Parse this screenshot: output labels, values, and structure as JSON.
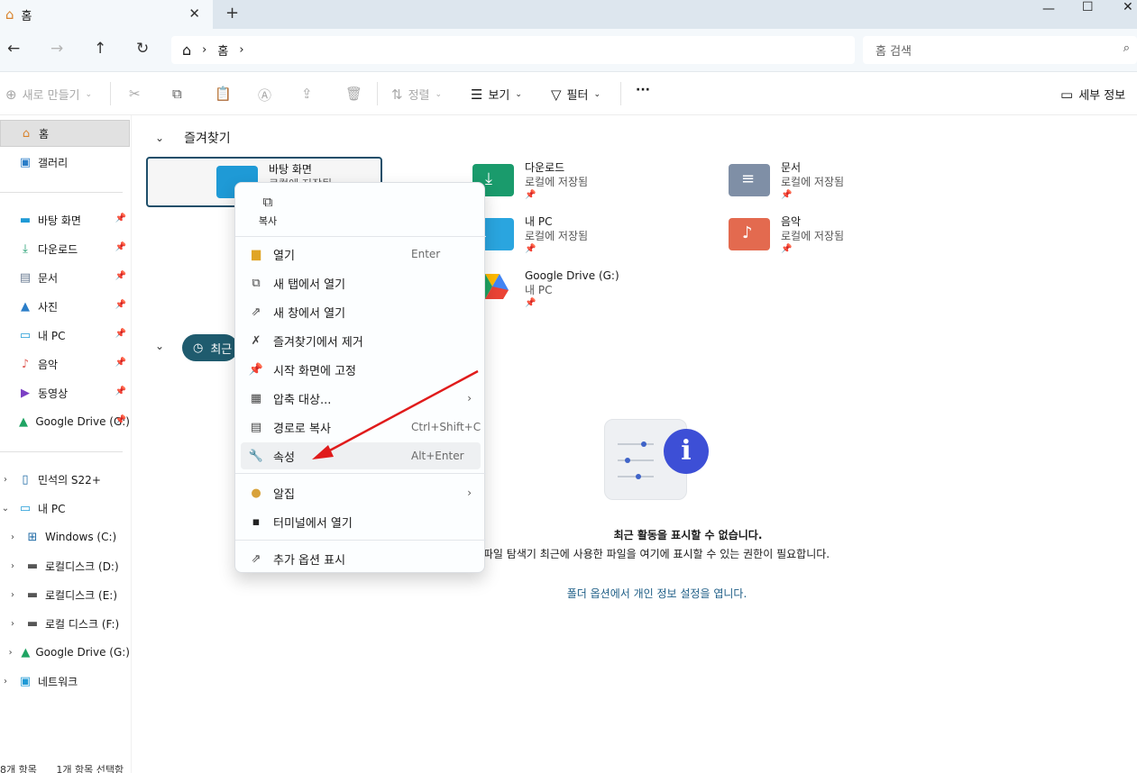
{
  "tab": {
    "title": "홈",
    "close": "✕",
    "new_tab": "+"
  },
  "window_controls": {
    "minimize": "—",
    "maximize": "☐",
    "close": "✕"
  },
  "address": {
    "home_icon": "⌂",
    "sep1": "›",
    "crumb": "홈",
    "sep2": "›"
  },
  "search": {
    "placeholder": "홈 검색"
  },
  "toolbar": {
    "new": "새로 만들기",
    "sort": "정렬",
    "view": "보기",
    "filter": "필터",
    "more": "···",
    "details": "세부 정보"
  },
  "sidebar": {
    "pinned": [
      {
        "label": "홈"
      },
      {
        "label": "갤러리"
      }
    ],
    "quick": [
      {
        "label": "바탕 화면"
      },
      {
        "label": "다운로드"
      },
      {
        "label": "문서"
      },
      {
        "label": "사진"
      },
      {
        "label": "내 PC"
      },
      {
        "label": "음악"
      },
      {
        "label": "동영상"
      },
      {
        "label": "Google Drive (G:)"
      }
    ],
    "tree": [
      {
        "label": "민석의 S22+"
      },
      {
        "label": "내 PC"
      },
      {
        "label": "Windows (C:)"
      },
      {
        "label": "로컬디스크 (D:)"
      },
      {
        "label": "로컬디스크 (E:)"
      },
      {
        "label": "로컬 디스크 (F:)"
      },
      {
        "label": "Google Drive (G:)"
      },
      {
        "label": "네트워크"
      }
    ]
  },
  "status": {
    "count": "8개 항목",
    "selected": "1개 항목 선택함"
  },
  "main": {
    "favorites_title": "즐겨찾기",
    "recent_label": "최근",
    "favorites": [
      {
        "name": "바탕 화면",
        "sub": "로컬에 저장됨"
      },
      {
        "name": "다운로드",
        "sub": "로컬에 저장됨"
      },
      {
        "name": "문서",
        "sub": "로컬에 저장됨"
      },
      {
        "name": "내 PC",
        "sub": "로컬에 저장됨"
      },
      {
        "name": "음악",
        "sub": "로컬에 저장됨"
      },
      {
        "name": "Google Drive (G:)",
        "sub": "내 PC"
      }
    ],
    "empty_title": "최근 활동을 표시할 수 없습니다.",
    "empty_desc": "파일 탐색기 최근에 사용한 파일을 여기에 표시할 수 있는 권한이 필요합니다.",
    "empty_link": "폴더 옵션에서 개인 정보 설정을 엽니다."
  },
  "context_menu": {
    "copy": "복사",
    "items": [
      {
        "label": "열기",
        "shortcut": "Enter"
      },
      {
        "label": "새 탭에서 열기"
      },
      {
        "label": "새 창에서 열기"
      },
      {
        "label": "즐겨찾기에서 제거"
      },
      {
        "label": "시작 화면에 고정"
      },
      {
        "label": "압축 대상..."
      },
      {
        "label": "경로로 복사",
        "shortcut": "Ctrl+Shift+C"
      },
      {
        "label": "속성",
        "shortcut": "Alt+Enter"
      },
      {
        "label": "알집"
      },
      {
        "label": "터미널에서 열기"
      },
      {
        "label": "추가 옵션 표시"
      }
    ]
  },
  "colors": {
    "accent": "#1f5b6e",
    "annotation_arrow": "#e01b1b",
    "info_blue": "#3d4fd6"
  }
}
